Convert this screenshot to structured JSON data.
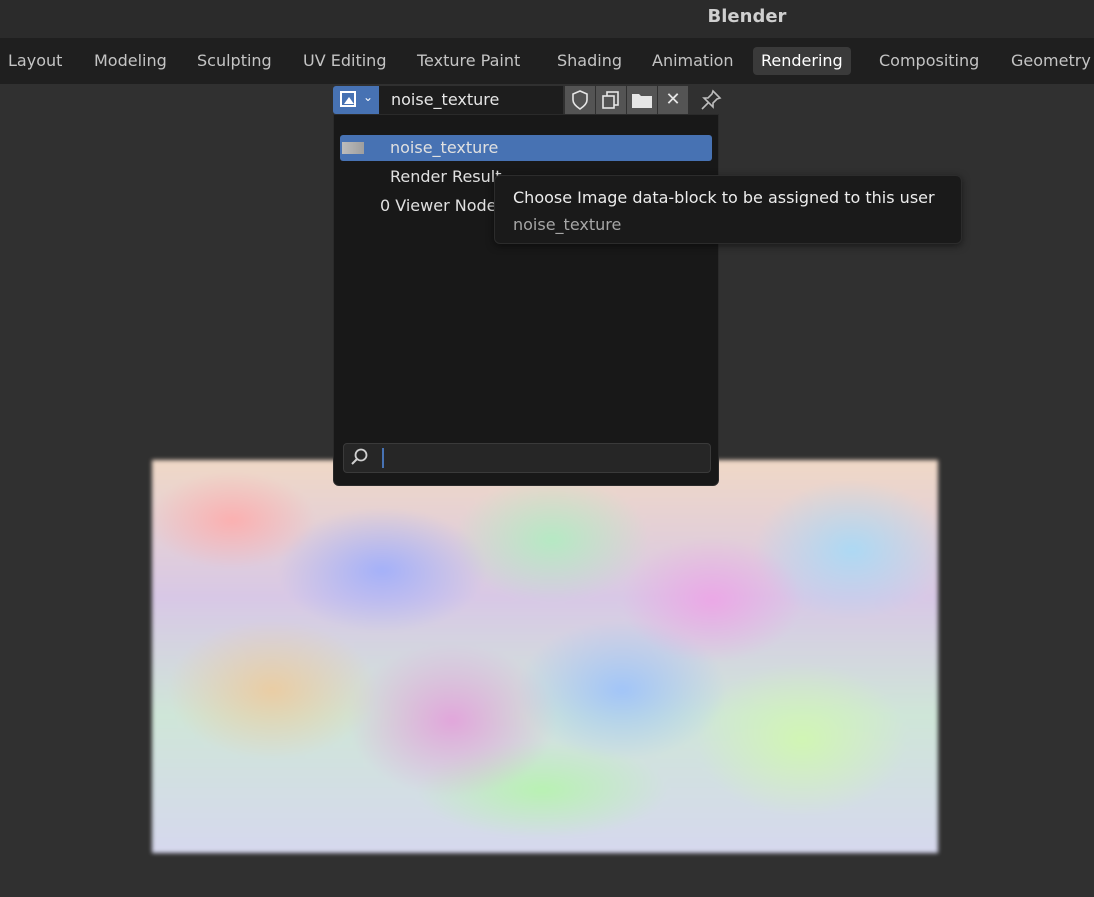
{
  "app": {
    "title": "Blender"
  },
  "workspace_tabs": [
    {
      "label": "Layout"
    },
    {
      "label": "Modeling"
    },
    {
      "label": "Sculpting"
    },
    {
      "label": "UV Editing"
    },
    {
      "label": "Texture Paint"
    },
    {
      "label": "Shading"
    },
    {
      "label": "Animation"
    },
    {
      "label": "Rendering",
      "active": true
    },
    {
      "label": "Compositing"
    },
    {
      "label": "Geometry"
    }
  ],
  "image_picker": {
    "current_name": "noise_texture",
    "icons": {
      "type": "image-icon",
      "fake_user": "shield-icon",
      "duplicate": "duplicate-icon",
      "open": "folder-icon",
      "unlink": "close-icon",
      "pin": "pin-icon"
    },
    "dropdown_items": [
      {
        "label": "noise_texture",
        "selected": true
      },
      {
        "label": "Render Result"
      },
      {
        "label": "0 Viewer Node"
      }
    ],
    "search": {
      "value": "",
      "placeholder": ""
    }
  },
  "tooltip": {
    "title": "Choose Image data-block to be assigned to this user",
    "subtitle": "noise_texture"
  },
  "colors": {
    "accent": "#4772b3",
    "background": "#303030",
    "menu_bg": "#181818"
  }
}
